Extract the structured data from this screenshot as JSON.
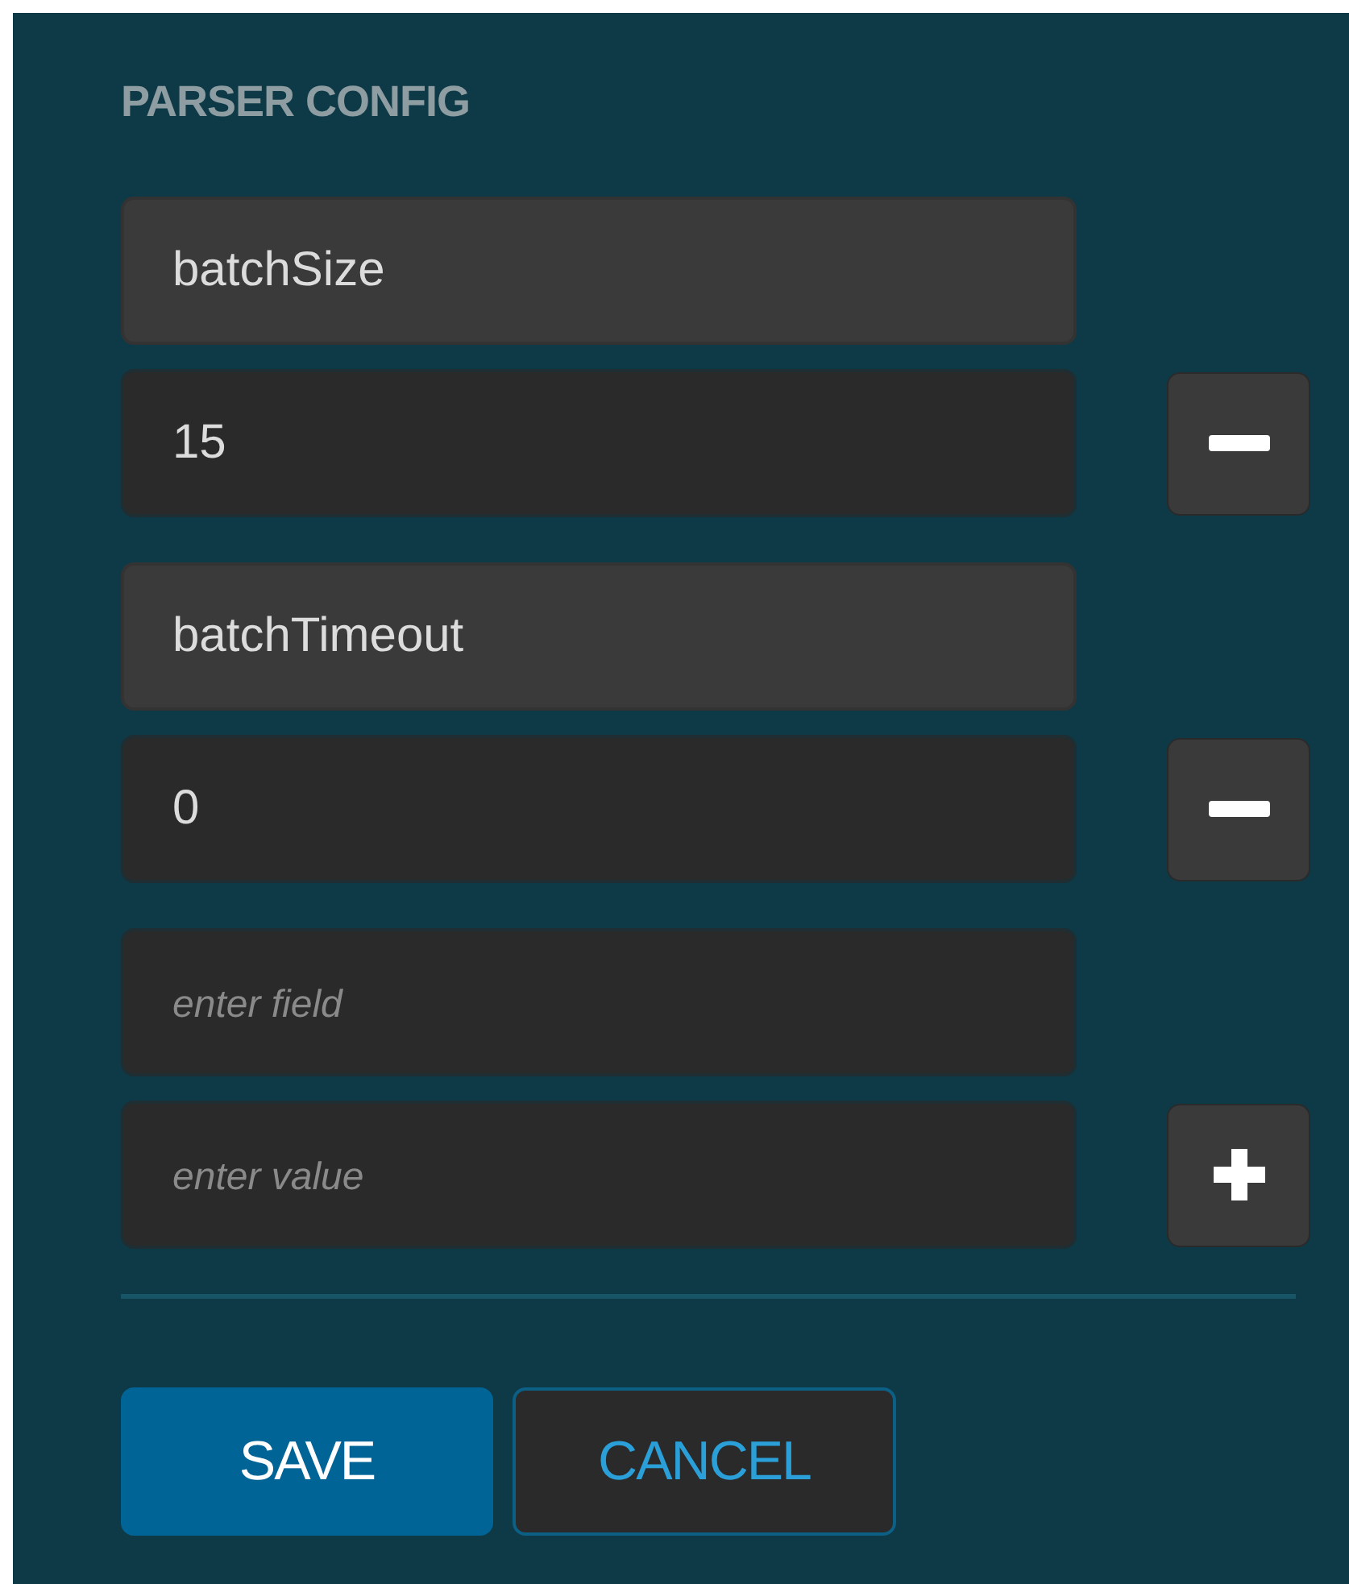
{
  "section_title": "PARSER CONFIG",
  "entries": [
    {
      "field": "batchSize",
      "value": "15"
    },
    {
      "field": "batchTimeout",
      "value": "0"
    }
  ],
  "new_entry": {
    "field_placeholder": "enter field",
    "value_placeholder": "enter value"
  },
  "buttons": [
    {
      "label": "SAVE",
      "kind": "primary"
    },
    {
      "label": "CANCEL",
      "kind": "secondary"
    }
  ]
}
